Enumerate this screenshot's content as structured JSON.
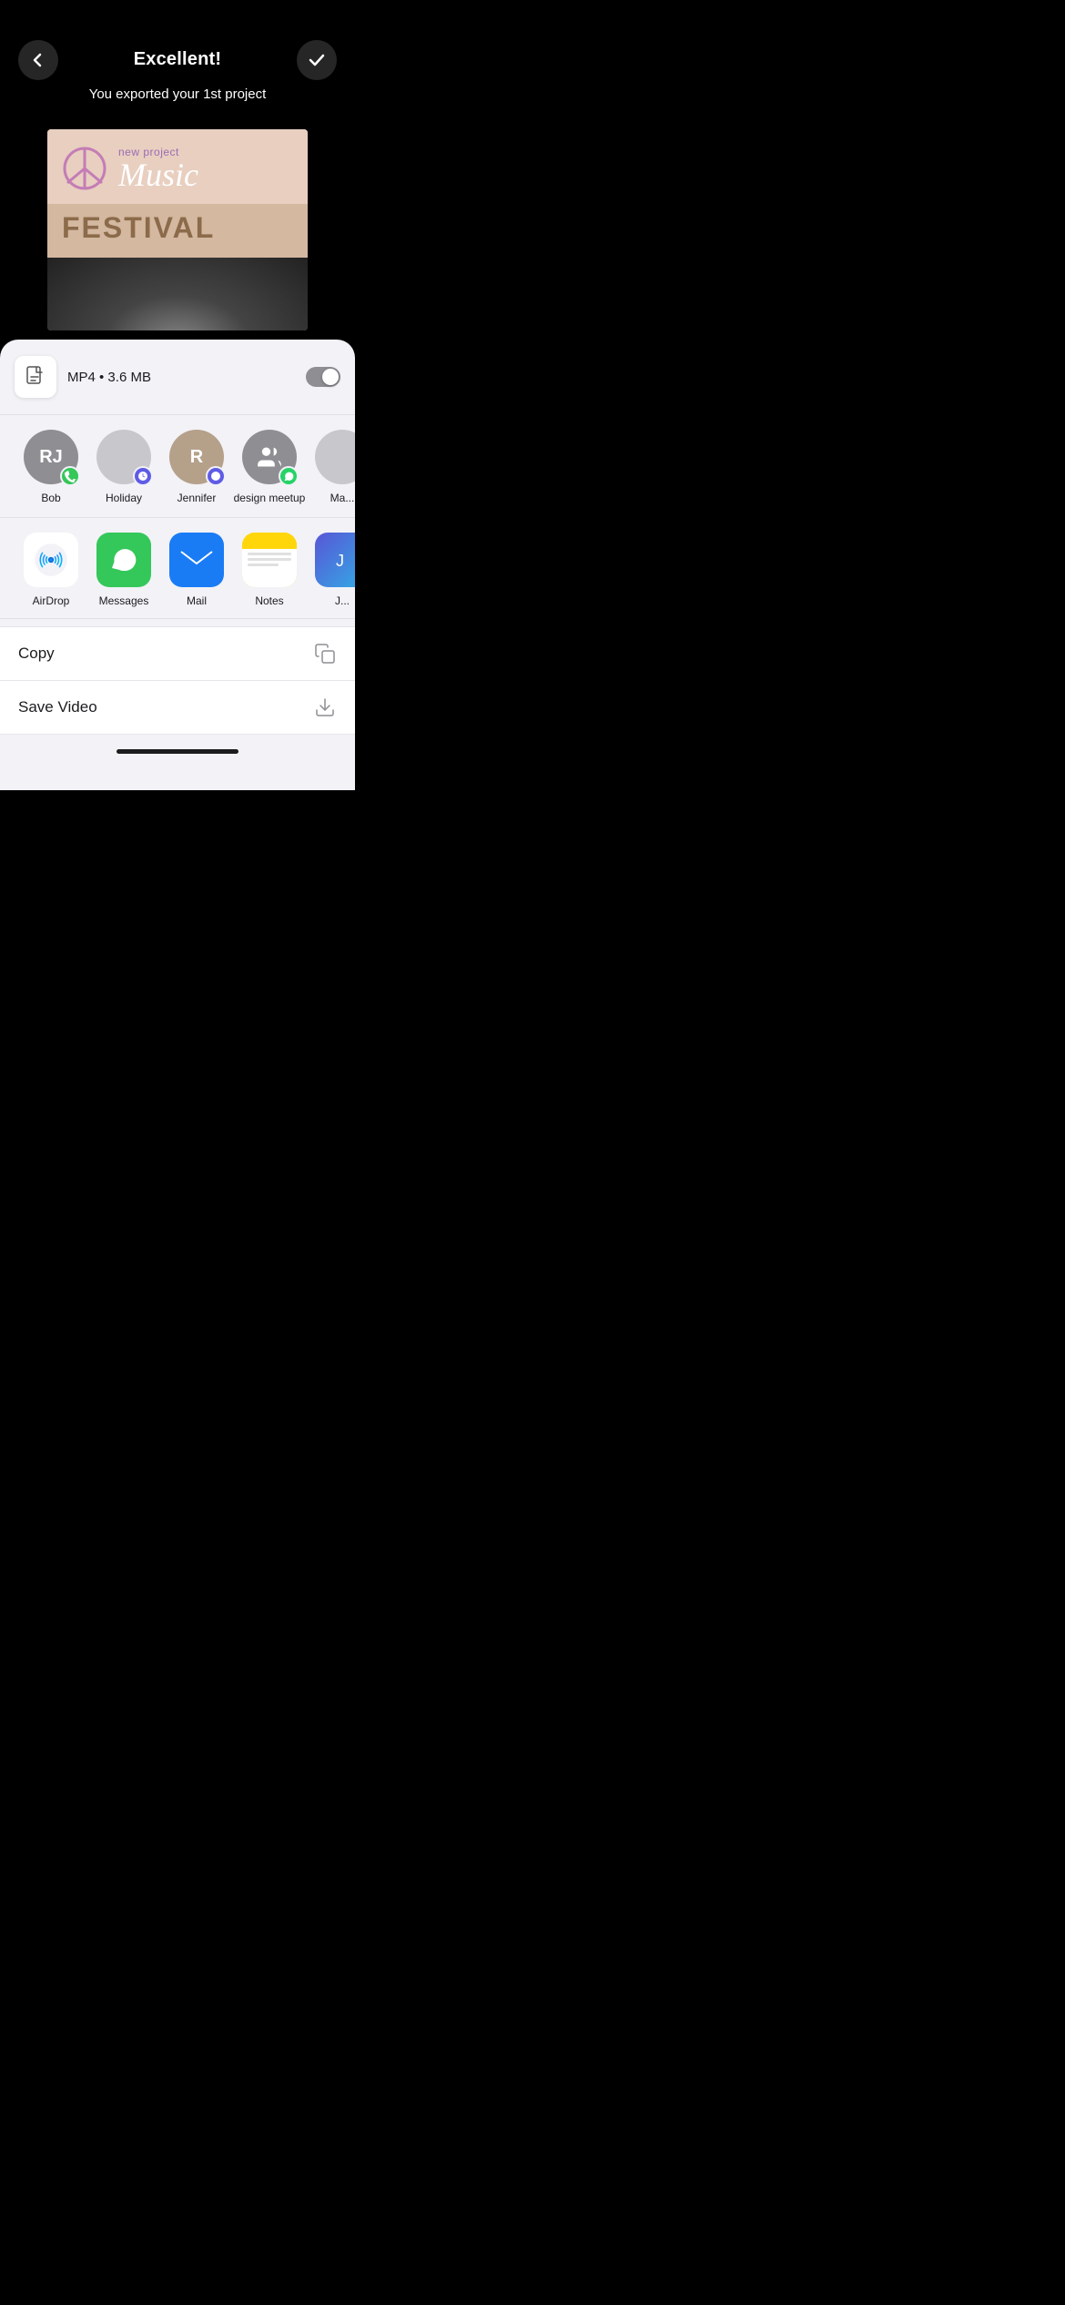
{
  "header": {
    "title": "Excellent!",
    "subtitle": "You exported your 1st project",
    "back_label": "back",
    "check_label": "done"
  },
  "preview": {
    "label": "new project",
    "music_text": "Music",
    "festival_text": "FESTIVAL"
  },
  "file_info": {
    "format": "MP4",
    "size": "3.6 MB",
    "display": "MP4 • 3.6 MB"
  },
  "contacts": [
    {
      "name": "Bob",
      "initials": "RJ",
      "bg": "#8e8e93",
      "badge_bg": "#34c759",
      "badge_icon": "messages"
    },
    {
      "name": "Holiday",
      "initials": "",
      "bg": "#c7c7cc",
      "badge_bg": "#5e5ce6",
      "badge_icon": "signal"
    },
    {
      "name": "Jennifer",
      "initials": "R",
      "bg": "#b5a08a",
      "badge_bg": "#5e5ce6",
      "badge_icon": "signal"
    },
    {
      "name": "design meetup",
      "initials": "👥",
      "bg": "#8e8e93",
      "badge_bg": "#25d366",
      "badge_icon": "whatsapp"
    },
    {
      "name": "Ma...",
      "initials": "",
      "bg": "#c7c7cc",
      "badge_bg": "#34c759",
      "badge_icon": "messages"
    }
  ],
  "apps": [
    {
      "name": "AirDrop",
      "type": "airdrop"
    },
    {
      "name": "Messages",
      "type": "messages"
    },
    {
      "name": "Mail",
      "type": "mail"
    },
    {
      "name": "Notes",
      "type": "notes"
    },
    {
      "name": "J...",
      "type": "other"
    }
  ],
  "actions": [
    {
      "label": "Copy",
      "icon": "copy"
    },
    {
      "label": "Save Video",
      "icon": "save"
    }
  ]
}
